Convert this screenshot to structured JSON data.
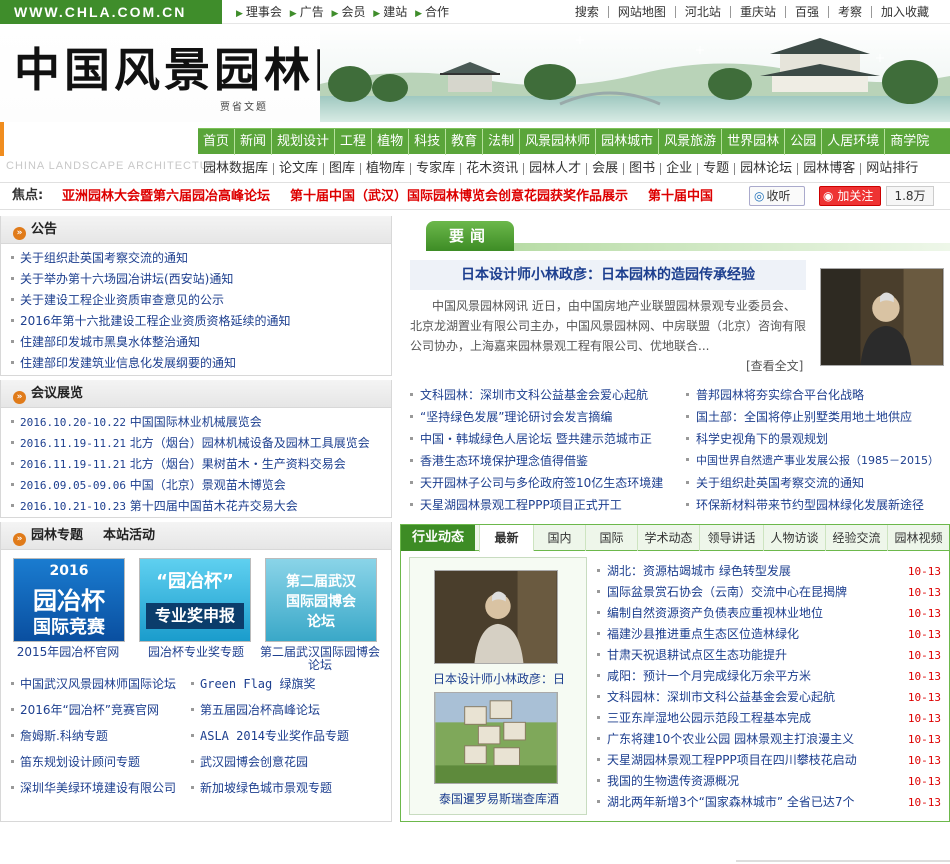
{
  "top": {
    "domain": "WWW.CHLA.COM.CN",
    "nav": [
      "理事会",
      "广告",
      "会员",
      "建站",
      "合作"
    ],
    "links": [
      "搜索",
      "网站地图",
      "河北站",
      "重庆站",
      "百强",
      "考察",
      "加入收藏"
    ]
  },
  "banner": {
    "logo": "中国风景园林网",
    "seal": "贾省文题",
    "subbrand": "CHINA LANDSCAPE ARCHITECTURE"
  },
  "nav1": [
    "首页",
    "新闻",
    "规划设计",
    "工程",
    "植物",
    "科技",
    "教育",
    "法制",
    "风景园林师",
    "园林城市",
    "风景旅游",
    "世界园林",
    "公园",
    "人居环境",
    "商学院"
  ],
  "nav2": [
    "园林数据库",
    "论文库",
    "图库",
    "植物库",
    "专家库",
    "花木资讯",
    "园林人才",
    "会展",
    "图书",
    "企业",
    "专题",
    "园林论坛",
    "园林博客",
    "网站排行"
  ],
  "hot": {
    "label": "焦点:",
    "items": [
      "亚洲园林大会暨第六届园冶高峰论坛",
      "第十届中国（武汉）国际园林博览会创意花园获奖作品展示",
      "第十届中国"
    ],
    "bookmark": "收听",
    "follow": "加关注",
    "fans": "1.8万"
  },
  "notice": {
    "title": "公告",
    "items": [
      "关于组织赴英国考察交流的通知",
      "关于举办第十六场园冶讲坛(西安站)通知",
      "关于建设工程企业资质审查意见的公示",
      "2016年第十六批建设工程企业资质资格延续的通知",
      "住建部印发城市黑臭水体整治通知",
      "住建部印发建筑业信息化发展纲要的通知"
    ]
  },
  "expo": {
    "title": "会议展览",
    "items": [
      {
        "date": "2016.10.20-10.22",
        "text": "中国国际林业机械展览会"
      },
      {
        "date": "2016.11.19-11.21",
        "text": "北方（烟台）园林机械设备及园林工具展览会"
      },
      {
        "date": "2016.11.19-11.21",
        "text": "北方（烟台）果树苗木・生产资料交易会"
      },
      {
        "date": "2016.09.05-09.06",
        "text": "中国（北京）景观苗木博览会"
      },
      {
        "date": "2016.10.21-10.23",
        "text": "第十四届中国苗木花卉交易大会"
      }
    ]
  },
  "projects": {
    "title": "园林专题",
    "title2": "本站活动",
    "tiles": [
      {
        "line1": "2016",
        "line2": "园冶杯",
        "line3": "国际竞赛",
        "caption": "2015年园冶杯官网"
      },
      {
        "line1": "“园冶杯”",
        "line2": "专业奖申报",
        "caption": "园冶杯专业奖专题"
      },
      {
        "line1": "第二届武汉",
        "line2": "国际园博会",
        "line3": "论坛",
        "caption": "第二届武汉国际园博会论坛"
      }
    ],
    "links": [
      "中国武汉风景园林师国际论坛",
      "Green Flag 绿旗奖",
      "2016年“园冶杯”竞赛官网",
      "第五届园冶杯高峰论坛",
      "詹姆斯.科纳专题",
      "ASLA 2014专业奖作品专题",
      "笛东规划设计顾问专题",
      "武汉园博会创意花园",
      "深圳华美绿环境建设有限公司",
      "新加坡绿色城市景观专题"
    ]
  },
  "yaowen": {
    "tab": "要闻",
    "headline": "日本设计师小林政彦：日本园林的造园传承经验",
    "summary": "中国风景园林网讯 近日，由中国房地产业联盟园林景观专业委员会、北京龙湖置业有限公司主办，中国风景园林网、中房联盟（北京）咨询有限公司协办，上海嘉来园林景观工程有限公司、优地联合...",
    "more": "[查看全文]",
    "left": [
      "文科园林：深圳市文科公益基金会爱心起航",
      "“坚持绿色发展”理论研讨会发言摘编",
      "中国・韩城绿色人居论坛 暨共建示范城市正",
      "香港生态环境保护理念值得借鉴",
      "天开园林子公司与多伦政府签10亿生态环境建",
      "天星湖园林景观工程PPP项目正式开工"
    ],
    "right": [
      "普邦园林将夯实综合平台化战略",
      "国土部：全国将停止别墅类用地土地供应",
      "科学史视角下的景观规划",
      "中国世界自然遗产事业发展公报（1985－2015）",
      "关于组织赴英国考察交流的通知",
      "环保新材料带来节约型园林绿化发展新途径"
    ]
  },
  "industry": {
    "title": "行业动态",
    "tabs": [
      "最新",
      "国内",
      "国际",
      "学术动态",
      "领导讲话",
      "人物访谈",
      "经验交流",
      "园林视频"
    ],
    "pic1": "日本设计师小林政彦：日",
    "pic2": "泰国暹罗易斯瑞查库酒",
    "items": [
      {
        "text": "湖北：资源枯竭城市 绿色转型发展",
        "date": "10-13"
      },
      {
        "text": "国际盆景赏石协会（云南）交流中心在昆揭牌",
        "date": "10-13"
      },
      {
        "text": "编制自然资源资产负债表应重视林业地位",
        "date": "10-13"
      },
      {
        "text": "福建沙县推进重点生态区位造林绿化",
        "date": "10-13"
      },
      {
        "text": "甘肃天祝退耕试点区生态功能提升",
        "date": "10-13"
      },
      {
        "text": "咸阳：预计一个月完成绿化万余平方米",
        "date": "10-13"
      },
      {
        "text": "文科园林：深圳市文科公益基金会爱心起航",
        "date": "10-13"
      },
      {
        "text": "三亚东岸湿地公园示范段工程基本完成",
        "date": "10-13"
      },
      {
        "text": "广东将建10个农业公园 园林景观主打浪漫主义",
        "date": "10-13"
      },
      {
        "text": "天星湖园林景观工程PPP项目在四川攀枝花启动",
        "date": "10-13"
      },
      {
        "text": "我国的生物遗传资源概况",
        "date": "10-13"
      },
      {
        "text": "湖北两年新增3个“国家森林城市” 全省已达7个",
        "date": "10-13"
      }
    ]
  }
}
